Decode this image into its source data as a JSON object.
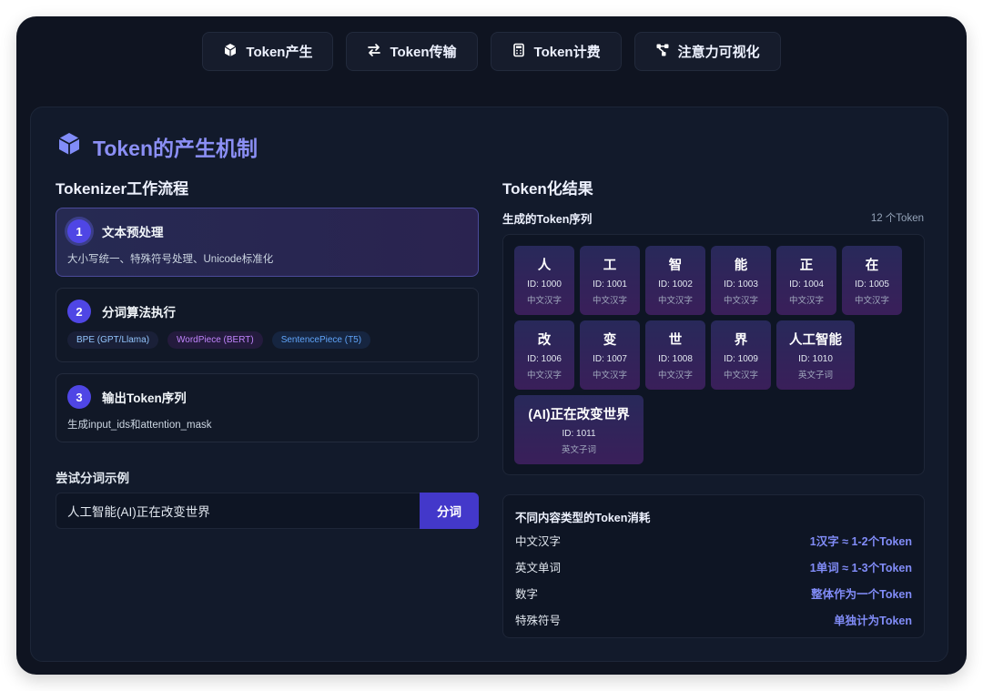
{
  "tabs": [
    {
      "label": "Token产生",
      "icon": "cube-icon"
    },
    {
      "label": "Token传输",
      "icon": "arrows-exchange-icon"
    },
    {
      "label": "Token计费",
      "icon": "calculator-icon"
    },
    {
      "label": "注意力可视化",
      "icon": "nodes-icon"
    }
  ],
  "panel": {
    "title": "Token的产生机制",
    "left_section_title": "Tokenizer工作流程",
    "right_section_title": "Token化结果"
  },
  "steps": [
    {
      "num": "1",
      "title": "文本预处理",
      "desc": "大小写统一、特殊符号处理、Unicode标准化",
      "active": true
    },
    {
      "num": "2",
      "title": "分词算法执行",
      "badges": [
        "BPE (GPT/Llama)",
        "WordPiece (BERT)",
        "SentencePiece (T5)"
      ],
      "active": false
    },
    {
      "num": "3",
      "title": "输出Token序列",
      "desc": "生成input_ids和attention_mask",
      "active": false
    }
  ],
  "try": {
    "label": "尝试分词示例",
    "input_value": "人工智能(AI)正在改变世界",
    "button_label": "分词"
  },
  "sequence": {
    "label": "生成的Token序列",
    "count": "12 个Token",
    "tokens": [
      {
        "text": "人",
        "id": "ID: 1000",
        "type": "中文汉字"
      },
      {
        "text": "工",
        "id": "ID: 1001",
        "type": "中文汉字"
      },
      {
        "text": "智",
        "id": "ID: 1002",
        "type": "中文汉字"
      },
      {
        "text": "能",
        "id": "ID: 1003",
        "type": "中文汉字"
      },
      {
        "text": "正",
        "id": "ID: 1004",
        "type": "中文汉字"
      },
      {
        "text": "在",
        "id": "ID: 1005",
        "type": "中文汉字"
      },
      {
        "text": "改",
        "id": "ID: 1006",
        "type": "中文汉字"
      },
      {
        "text": "变",
        "id": "ID: 1007",
        "type": "中文汉字"
      },
      {
        "text": "世",
        "id": "ID: 1008",
        "type": "中文汉字"
      },
      {
        "text": "界",
        "id": "ID: 1009",
        "type": "中文汉字"
      },
      {
        "text": "人工智能",
        "id": "ID: 1010",
        "type": "英文子词"
      },
      {
        "text": "(AI)正在改变世界",
        "id": "ID: 1011",
        "type": "英文子词"
      }
    ]
  },
  "cost": {
    "title": "不同内容类型的Token消耗",
    "rows": [
      {
        "key": "中文汉字",
        "value": "1汉字 ≈ 1-2个Token"
      },
      {
        "key": "英文单词",
        "value": "1单词 ≈ 1-3个Token"
      },
      {
        "key": "数字",
        "value": "整体作为一个Token"
      },
      {
        "key": "特殊符号",
        "value": "单独计为Token"
      }
    ]
  },
  "colors": {
    "accent": "#818cf8",
    "step_number": "#4f46e5",
    "button": "#4338ca",
    "badge_bpe": "#93c5fd",
    "badge_wordpiece": "#c084fc",
    "badge_sentencepiece": "#60a5fa"
  }
}
